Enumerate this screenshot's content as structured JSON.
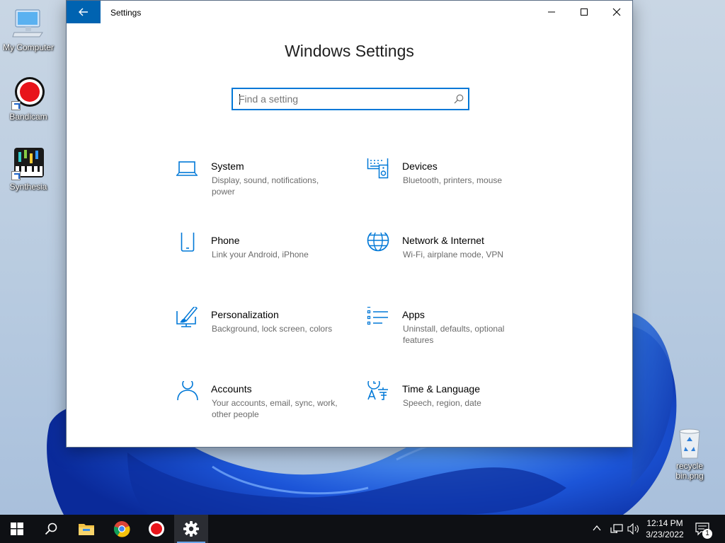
{
  "desktop": {
    "icons": [
      {
        "label": "My Computer",
        "icon": "computer-icon"
      },
      {
        "label": "Bandicam",
        "icon": "record-icon"
      },
      {
        "label": "Synthesia",
        "icon": "piano-icon"
      },
      {
        "label": "recycle bin.png",
        "icon": "recycle-bin-icon"
      }
    ]
  },
  "window": {
    "title": "Settings",
    "back_icon": "back-arrow-icon",
    "controls": [
      "minimize-icon",
      "maximize-icon",
      "close-icon"
    ],
    "heading": "Windows Settings",
    "search": {
      "placeholder": "Find a setting",
      "value": "",
      "icon": "search-icon"
    },
    "categories": [
      {
        "name": "System",
        "desc": "Display, sound, notifications, power",
        "icon": "laptop-icon"
      },
      {
        "name": "Devices",
        "desc": "Bluetooth, printers, mouse",
        "icon": "keyboard-speaker-icon"
      },
      {
        "name": "Phone",
        "desc": "Link your Android, iPhone",
        "icon": "phone-icon"
      },
      {
        "name": "Network & Internet",
        "desc": "Wi-Fi, airplane mode, VPN",
        "icon": "globe-icon"
      },
      {
        "name": "Personalization",
        "desc": "Background, lock screen, colors",
        "icon": "paint-brush-icon"
      },
      {
        "name": "Apps",
        "desc": "Uninstall, defaults, optional features",
        "icon": "apps-list-icon"
      },
      {
        "name": "Accounts",
        "desc": "Your accounts, email, sync, work, other people",
        "icon": "person-icon"
      },
      {
        "name": "Time & Language",
        "desc": "Speech, region, date",
        "icon": "time-language-icon"
      }
    ]
  },
  "taskbar": {
    "items": [
      "start-icon",
      "search-icon",
      "file-explorer-icon",
      "chrome-icon",
      "bandicam-icon",
      "settings-gear-icon"
    ],
    "tray": [
      "chevron-up-icon",
      "network-icon",
      "volume-icon"
    ],
    "time": "12:14 PM",
    "date": "3/23/2022",
    "notifications_count": "1"
  },
  "colors": {
    "accent": "#0063b1",
    "icon_blue": "#0078d7",
    "taskbar": "#0e1014"
  }
}
